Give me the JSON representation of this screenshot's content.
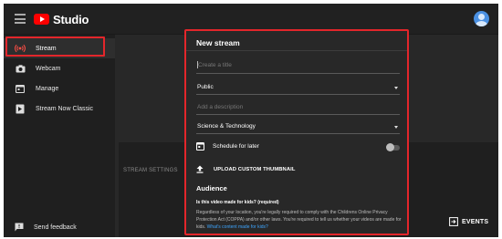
{
  "app": {
    "title": "Studio"
  },
  "sidebar": {
    "items": [
      {
        "label": "Stream",
        "icon": "live-broadcast-icon"
      },
      {
        "label": "Webcam",
        "icon": "camera-icon"
      },
      {
        "label": "Manage",
        "icon": "calendar-icon"
      },
      {
        "label": "Stream Now Classic",
        "icon": "stream-now-icon"
      }
    ],
    "feedback": "Send feedback"
  },
  "main": {
    "stream_settings": "STREAM SETTINGS",
    "events_button": "EVENTS"
  },
  "dialog": {
    "title": "New stream",
    "title_placeholder": "Create a title",
    "visibility": "Public",
    "description_placeholder": "Add a description",
    "category": "Science & Technology",
    "schedule_label": "Schedule for later",
    "schedule_enabled": false,
    "upload_thumbnail": "UPLOAD CUSTOM THUMBNAIL",
    "audience_heading": "Audience",
    "kids_question": "Is this video made for kids? (required)",
    "kids_description": "Regardless of your location, you're legally required to comply with the Childrens Online Privacy Protection Act (COPPA) and/or other laws. You're required to tell us whether your videos are made for kids.",
    "kids_link": "What's content made for kids?"
  },
  "colors": {
    "accent_red": "#ff0000",
    "highlight_border": "#e3262b",
    "link_blue": "#3ea6ff",
    "background": "#282828"
  }
}
